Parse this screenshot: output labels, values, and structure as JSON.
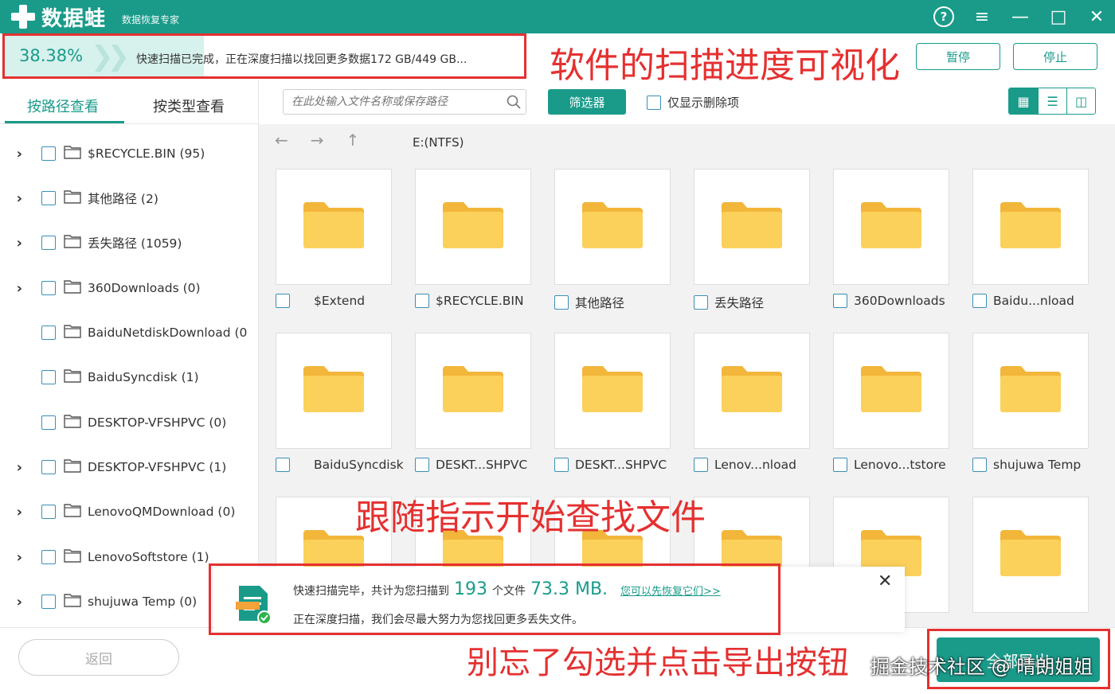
{
  "app": {
    "name": "数据蛙",
    "subtitle": "数据恢复专家"
  },
  "window": {
    "help": "?",
    "menu": "≡",
    "minimize": "—",
    "maximize": "□",
    "close": "✕"
  },
  "scan": {
    "percent_text": "38.38%",
    "progress": 0.3838,
    "status_text": "快速扫描已完成，正在深度扫描以找回更多数据172 GB/449 GB...",
    "pause_label": "暂停",
    "stop_label": "停止"
  },
  "annotations": {
    "top": "软件的扫描进度可视化",
    "middle": "跟随指示开始查找文件",
    "bottom": "别忘了勾选并点击导出按钮"
  },
  "tabs": {
    "by_path": "按路径查看",
    "by_type": "按类型查看"
  },
  "toolbar": {
    "search_placeholder": "在此处输入文件名称或保存路径",
    "filter_label": "筛选器",
    "deleted_only_label": "仅显示删除项"
  },
  "tree": [
    {
      "label": "$RECYCLE.BIN (95)",
      "expandable": true
    },
    {
      "label": "其他路径 (2)",
      "expandable": true
    },
    {
      "label": "丢失路径 (1059)",
      "expandable": true
    },
    {
      "label": "360Downloads (0)",
      "expandable": true
    },
    {
      "label": "BaiduNetdiskDownload (0",
      "expandable": false
    },
    {
      "label": "BaiduSyncdisk (1)",
      "expandable": false
    },
    {
      "label": "DESKTOP-VFSHPVC (0)",
      "expandable": false
    },
    {
      "label": "DESKTOP-VFSHPVC (1)",
      "expandable": true
    },
    {
      "label": "LenovoQMDownload (0)",
      "expandable": true
    },
    {
      "label": "LenovoSoftstore (1)",
      "expandable": true
    },
    {
      "label": "shujuwa Temp (0)",
      "expandable": true
    }
  ],
  "nav": {
    "path": "E:(NTFS)"
  },
  "grid": {
    "row1": [
      "$Extend",
      "$RECYCLE.BIN",
      "其他路径",
      "丢失路径",
      "360Downloads",
      "Baidu...nload"
    ],
    "row2": [
      "BaiduSyncdisk",
      "DESKT...SHPVC",
      "DESKT...SHPVC",
      "Lenov...nload",
      "Lenovo...tstore",
      "shujuwa Temp"
    ]
  },
  "toast": {
    "line1_prefix": "快速扫描完毕，共计为您扫描到",
    "file_count": "193",
    "files_unit": "个文件",
    "size": "73.3 MB.",
    "link": "您可以先恢复它们>>",
    "line2": "正在深度扫描，我们会尽最大努力为您找回更多丢失文件。",
    "close": "✕"
  },
  "bottom": {
    "back_label": "返回",
    "export_label": "全部导出"
  },
  "watermark": "掘金技术社区 @ 晴朗姐姐",
  "colors": {
    "brand": "#1a9b8a",
    "annotation": "#e53030",
    "folder": "#f9c74f"
  }
}
